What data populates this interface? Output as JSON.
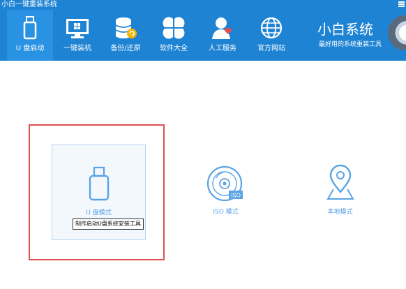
{
  "app": {
    "title": "小白一键重装系统"
  },
  "nav": {
    "items": [
      {
        "label": "U 盘启动",
        "icon": "usb-drive-icon",
        "active": true
      },
      {
        "label": "一键装机",
        "icon": "monitor-windows-icon"
      },
      {
        "label": "备份/还原",
        "icon": "database-backup-icon"
      },
      {
        "label": "软件大全",
        "icon": "clover-apps-icon"
      },
      {
        "label": "人工服务",
        "icon": "user-heart-icon"
      },
      {
        "label": "官方网站",
        "icon": "globe-icon"
      }
    ]
  },
  "brand": {
    "title": "小白系统",
    "subtitle": "最好用的系统重装工具"
  },
  "modes": [
    {
      "label": "U 盘模式",
      "icon": "usb-drive-icon"
    },
    {
      "label": "ISO 模式",
      "icon": "iso-disc-icon",
      "badge": "ISO"
    },
    {
      "label": "本地模式",
      "icon": "location-pin-icon"
    }
  ],
  "tooltip": {
    "text": "制作启动U盘系统安装工具"
  },
  "colors": {
    "header_bg": "#1e83d3",
    "active_tab": "#2a92e3",
    "accent": "#5aa3e6",
    "highlight_border": "#e0514e"
  }
}
